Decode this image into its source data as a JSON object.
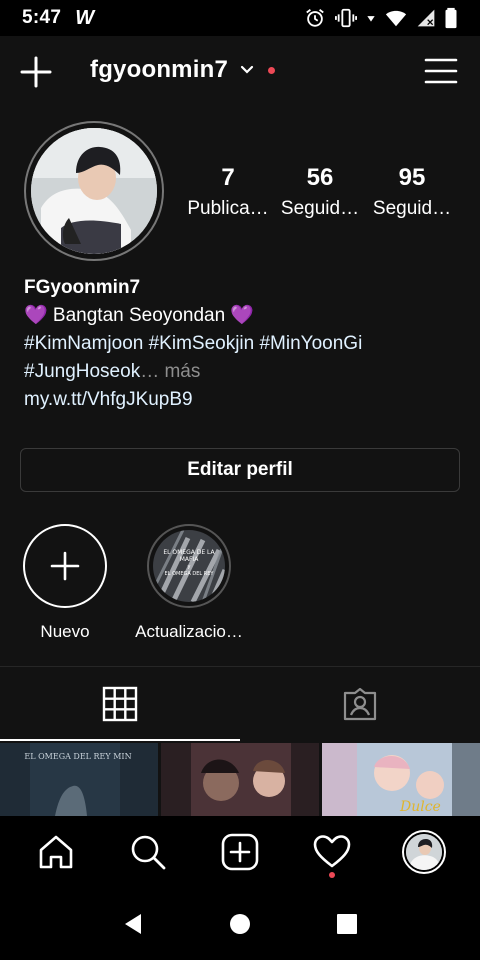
{
  "status_bar": {
    "time": "5:47",
    "app_glyph": "W"
  },
  "header": {
    "username": "fgyoonmin7"
  },
  "profile": {
    "stats": [
      {
        "value": "7",
        "label": "Publica…"
      },
      {
        "value": "56",
        "label": "Seguid…"
      },
      {
        "value": "95",
        "label": "Seguid…"
      }
    ],
    "name": "FGyoonmin7",
    "bio_line1": "💜 Bangtan Seoyondan 💜",
    "bio_line2": "#KimNamjoon #KimSeokjin #MinYoonGi",
    "bio_line3": "#JungHoseok",
    "more": "… más",
    "link": "my.w.tt/VhfgJKupB9",
    "edit_button": "Editar perfil"
  },
  "highlights": [
    {
      "label": "Nuevo",
      "icon": "plus-icon"
    },
    {
      "label": "Actualizacio…",
      "cover_text": [
        "EL OMEGA DE LA",
        "MAFIA",
        "y",
        "EL OMEGA DEL REY"
      ]
    }
  ],
  "tabs": [
    {
      "name": "grid",
      "icon": "grid-icon",
      "active": true
    },
    {
      "name": "tagged",
      "icon": "tagged-icon",
      "active": false
    }
  ],
  "posts": [
    {
      "title": "EL OMEGA DEL REY MIN"
    },
    {
      "title": ""
    },
    {
      "title": "Dulce"
    }
  ],
  "colors": {
    "background": "#121212",
    "accent_red": "#ed4956",
    "link": "#e0f1ff",
    "muted": "#8e8e8e"
  }
}
